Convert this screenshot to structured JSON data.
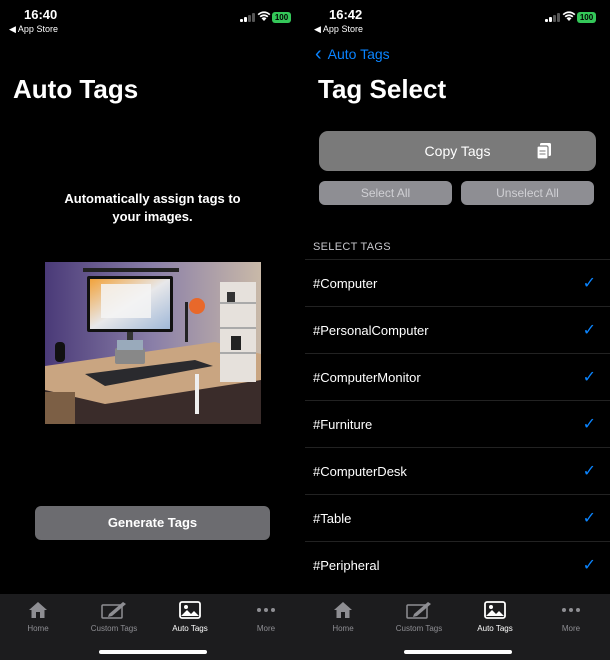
{
  "left": {
    "status": {
      "time": "16:40",
      "back_app": "◀ App Store",
      "battery": "100"
    },
    "title": "Auto Tags",
    "description": "Automatically assign tags to your images.",
    "generate_label": "Generate Tags"
  },
  "right": {
    "status": {
      "time": "16:42",
      "back_app": "◀ App Store",
      "battery": "100"
    },
    "back_label": "Auto Tags",
    "title": "Tag Select",
    "copy_label": "Copy Tags",
    "select_all_label": "Select All",
    "unselect_all_label": "Unselect All",
    "section_header": "SELECT TAGS",
    "tags": [
      {
        "name": "#Computer",
        "checked": true
      },
      {
        "name": "#PersonalComputer",
        "checked": true
      },
      {
        "name": "#ComputerMonitor",
        "checked": true
      },
      {
        "name": "#Furniture",
        "checked": true
      },
      {
        "name": "#ComputerDesk",
        "checked": true
      },
      {
        "name": "#Table",
        "checked": true
      },
      {
        "name": "#Peripheral",
        "checked": true
      }
    ]
  },
  "tabs": [
    {
      "label": "Home",
      "icon": "house-icon"
    },
    {
      "label": "Custom Tags",
      "icon": "edit-icon"
    },
    {
      "label": "Auto Tags",
      "icon": "photo-icon",
      "active": true
    },
    {
      "label": "More",
      "icon": "ellipsis-icon"
    }
  ],
  "colors": {
    "accent": "#0a84ff",
    "battery": "#34c759",
    "tabbar": "#1c1c1e"
  }
}
